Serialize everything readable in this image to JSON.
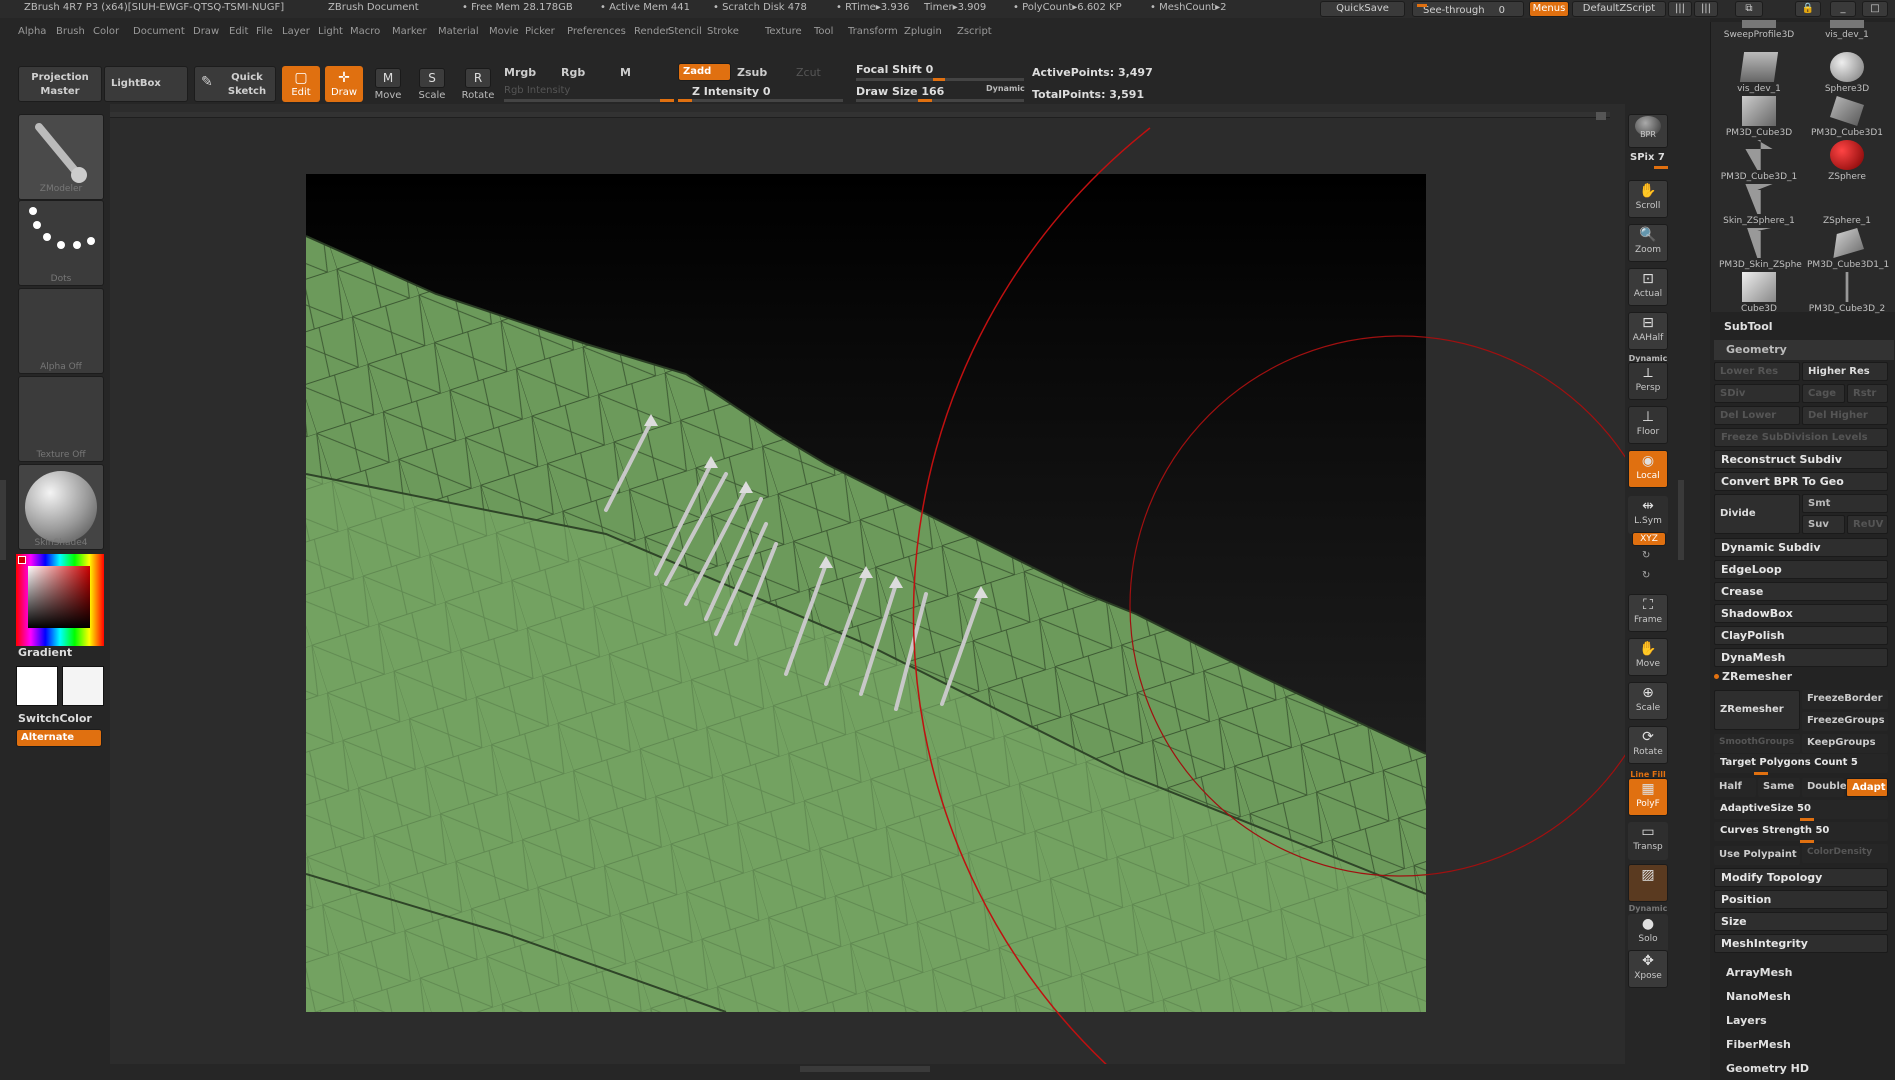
{
  "title_bar": {
    "app": "ZBrush 4R7 P3 (x64)[SIUH-EWGF-QTSQ-TSMI-NUGF]",
    "doc": "ZBrush Document",
    "free_mem": "• Free Mem 28.178GB",
    "active_mem": "• Active Mem 441",
    "scratch": "• Scratch Disk 478",
    "rtime": "• RTime▸3.936",
    "timer": "Timer▸3.909",
    "polycount": "• PolyCount▸6.602 KP",
    "meshcount": "• MeshCount▸2",
    "quicksave": "QuickSave",
    "see_through": "See-through",
    "see_through_value": "0",
    "menus": "Menus",
    "script": "DefaultZScript"
  },
  "menu": [
    "Alpha",
    "Brush",
    "Color",
    "Document",
    "Draw",
    "Edit",
    "File",
    "Layer",
    "Light",
    "Macro",
    "Marker",
    "Material",
    "Movie",
    "Picker",
    "Preferences",
    "Render",
    "Stencil",
    "Stroke",
    "Texture",
    "Tool",
    "Transform",
    "Zplugin",
    "Zscript"
  ],
  "toolbar": {
    "projection_master": "Projection Master",
    "lightbox": "LightBox",
    "quick_sketch": "Quick Sketch",
    "edit": "Edit",
    "draw": "Draw",
    "move": "Move",
    "scale": "Scale",
    "rotate": "Rotate",
    "mrgb": "Mrgb",
    "rgb": "Rgb",
    "m": "M",
    "zadd": "Zadd",
    "zsub": "Zsub",
    "zcut": "Zcut",
    "rgb_intensity": "Rgb Intensity",
    "z_intensity": "Z Intensity 0",
    "z_intensity_value": 0,
    "focal_shift": "Focal Shift 0",
    "focal_shift_value": 0,
    "draw_size": "Draw Size 166",
    "draw_size_value": 166,
    "dynamic": "Dynamic",
    "active_points": "ActivePoints: 3,497",
    "total_points": "TotalPoints: 3,591"
  },
  "left_shelf": {
    "brush": "ZModeler",
    "stroke": "Dots",
    "alpha": "Alpha Off",
    "texture": "Texture Off",
    "material": "SkinShade4",
    "gradient": "Gradient",
    "switch_color": "SwitchColor",
    "alternate": "Alternate"
  },
  "right_shelf": {
    "bpr": "BPR",
    "spix": "SPix 7",
    "scroll": "Scroll",
    "zoom": "Zoom",
    "actual": "Actual",
    "aahalf": "AAHalf",
    "dynamic": "Dynamic",
    "persp": "Persp",
    "floor": "Floor",
    "local": "Local",
    "lsym": "L.Sym",
    "xyz": "XYZ",
    "frame": "Frame",
    "move": "Move",
    "scale": "Scale",
    "rotate": "Rotate",
    "line_fill": "Line Fill",
    "polyf": "PolyF",
    "transp": "Transp",
    "dynamic2": "Dynamic",
    "solo": "Solo",
    "xpose": "Xpose"
  },
  "tools": [
    {
      "label": "SweepProfile3D"
    },
    {
      "label": "vis_dev_1"
    },
    {
      "label": "vis_dev_1"
    },
    {
      "label": "Sphere3D"
    },
    {
      "label": "PM3D_Cube3D"
    },
    {
      "label": "PM3D_Cube3D1"
    },
    {
      "label": "PM3D_Cube3D_1"
    },
    {
      "label": "ZSphere"
    },
    {
      "label": "Skin_ZSphere_1"
    },
    {
      "label": "ZSphere_1"
    },
    {
      "label": "PM3D_Skin_ZSphe"
    },
    {
      "label": "PM3D_Cube3D1_1"
    },
    {
      "label": "Cube3D"
    },
    {
      "label": "PM3D_Cube3D_2"
    }
  ],
  "right_panel": {
    "subtool": "SubTool",
    "geometry": "Geometry",
    "lower_res": "Lower Res",
    "higher_res": "Higher Res",
    "sdiv": "SDiv",
    "cage": "Cage",
    "rstr": "Rstr",
    "del_lower": "Del Lower",
    "del_higher": "Del Higher",
    "freeze_subdiv": "Freeze SubDivision Levels",
    "reconstruct_subdiv": "Reconstruct Subdiv",
    "convert_bpr": "Convert BPR To Geo",
    "divide": "Divide",
    "smt": "Smt",
    "suv": "Suv",
    "reuv": "ReUV",
    "dynamic_subdiv": "Dynamic Subdiv",
    "edgeloop": "EdgeLoop",
    "crease": "Crease",
    "shadowbox": "ShadowBox",
    "claypolish": "ClayPolish",
    "dynamesh": "DynaMesh",
    "zremesher_header": "ZRemesher",
    "zremesher_btn": "ZRemesher",
    "freeze_border": "FreezeBorder",
    "freeze_groups": "FreezeGroups",
    "smooth_groups": "SmoothGroups",
    "keep_groups": "KeepGroups",
    "target_polygons": "Target Polygons Count 5",
    "half": "Half",
    "same": "Same",
    "double": "Double",
    "adapt": "Adapt",
    "adaptive_size": "AdaptiveSize 50",
    "adaptive_size_value": 50,
    "curves_strength": "Curves Strength 50",
    "curves_strength_value": 50,
    "use_polypaint": "Use Polypaint",
    "color_density": "ColorDensity",
    "modify_topology": "Modify Topology",
    "position": "Position",
    "size": "Size",
    "mesh_integrity": "MeshIntegrity",
    "arraymesh": "ArrayMesh",
    "nanomesh": "NanoMesh",
    "layers": "Layers",
    "fibermesh": "FiberMesh",
    "geometry_hd": "Geometry HD"
  },
  "colors": {
    "accent": "#e07010",
    "mesh_green": "#6e9a5e",
    "background": "#262626"
  }
}
